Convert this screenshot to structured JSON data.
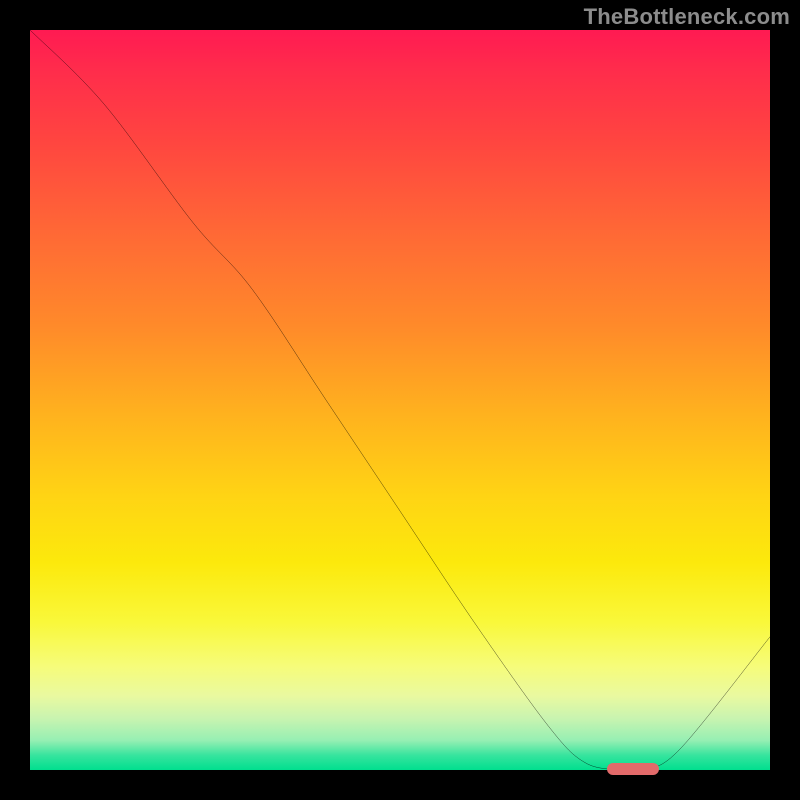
{
  "watermark": "TheBottleneck.com",
  "colors": {
    "background": "#000000",
    "curve_stroke": "#000000",
    "marker_fill": "#e26a6a",
    "gradient_top": "#ff1a52",
    "gradient_bottom": "#00df8f"
  },
  "chart_data": {
    "type": "line",
    "title": "",
    "xlabel": "",
    "ylabel": "",
    "xlim": [
      0,
      100
    ],
    "ylim": [
      0,
      100
    ],
    "grid": false,
    "legend": false,
    "series": [
      {
        "name": "bottleneck-curve",
        "x": [
          0,
          10,
          22,
          30,
          40,
          50,
          60,
          70,
          75,
          80,
          83,
          88,
          100
        ],
        "values": [
          100,
          90,
          74,
          65,
          50,
          35,
          20,
          6,
          1,
          0,
          0,
          3,
          18
        ]
      }
    ],
    "markers": [
      {
        "name": "optimal-range",
        "x_start": 78,
        "x_end": 85,
        "y": 0
      }
    ],
    "annotations": []
  }
}
